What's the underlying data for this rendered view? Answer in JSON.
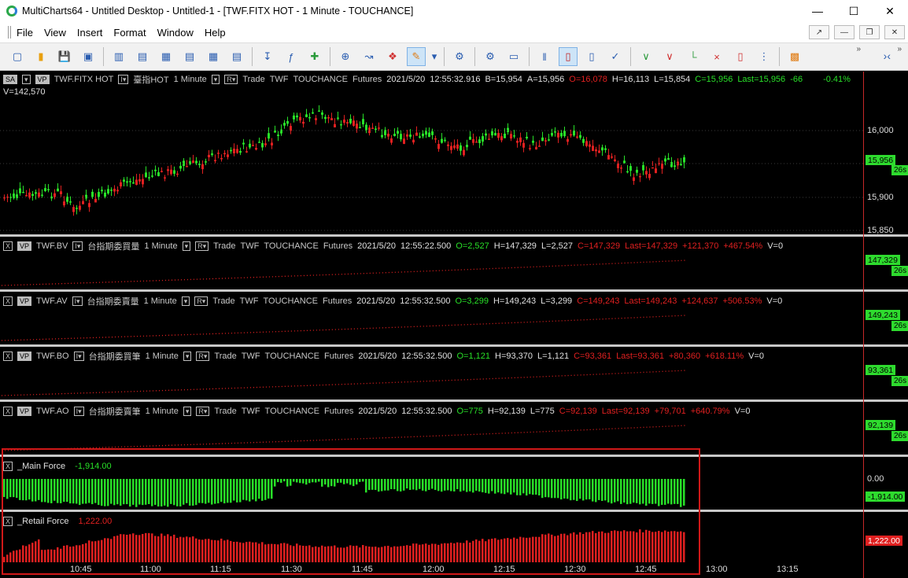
{
  "window": {
    "title": "MultiCharts64 - Untitled Desktop - Untitled-1 - [TWF.FITX HOT - 1 Minute - TOUCHANCE]"
  },
  "menu": [
    "File",
    "View",
    "Insert",
    "Format",
    "Window",
    "Help"
  ],
  "main_pane": {
    "symbol": "TWF.FITX HOT",
    "name": "臺指HOT",
    "interval": "1 Minute",
    "trade": "Trade",
    "exch": "TWF",
    "feed": "TOUCHANCE",
    "category": "Futures",
    "date": "2021/5/20",
    "time": "12:55:32.916",
    "bid": "B=15,954",
    "ask": "A=15,956",
    "open": "O=16,078",
    "high": "H=16,113",
    "low": "L=15,854",
    "close": "C=15,956",
    "last": "Last=15,956",
    "change": "-66",
    "pct": "-0.41%",
    "volume": "V=142,570",
    "axis": [
      "16,000",
      "15,900",
      "15,850"
    ],
    "price_tag": "15,956",
    "timer": "26s"
  },
  "sub_panes": [
    {
      "symbol": "TWF.BV",
      "name": "台指期委買量",
      "interval": "1 Minute",
      "time": "12:55:22.500",
      "open": "O=2,527",
      "high": "H=147,329",
      "low": "L=2,527",
      "close": "C=147,329",
      "last": "Last=147,329",
      "change": "+121,370",
      "pct": "+467.54%",
      "vol": "V=0",
      "tag": "147,329",
      "timer": "26s"
    },
    {
      "symbol": "TWF.AV",
      "name": "台指期委賣量",
      "interval": "1 Minute",
      "time": "12:55:32.500",
      "open": "O=3,299",
      "high": "H=149,243",
      "low": "L=3,299",
      "close": "C=149,243",
      "last": "Last=149,243",
      "change": "+124,637",
      "pct": "+506.53%",
      "vol": "V=0",
      "tag": "149,243",
      "timer": "26s"
    },
    {
      "symbol": "TWF.BO",
      "name": "台指期委買筆",
      "interval": "1 Minute",
      "time": "12:55:32.500",
      "open": "O=1,121",
      "high": "H=93,370",
      "low": "L=1,121",
      "close": "C=93,361",
      "last": "Last=93,361",
      "change": "+80,360",
      "pct": "+618.11%",
      "vol": "V=0",
      "tag": "93,361",
      "timer": "26s"
    },
    {
      "symbol": "TWF.AO",
      "name": "台指期委賣筆",
      "interval": "1 Minute",
      "time": "12:55:32.500",
      "open": "O=775",
      "high": "H=92,139",
      "low": "L=775",
      "close": "C=92,139",
      "last": "Last=92,139",
      "change": "+79,701",
      "pct": "+640.79%",
      "vol": "V=0",
      "tag": "92,139",
      "timer": "26s"
    }
  ],
  "common": {
    "trade": "Trade",
    "exch": "TWF",
    "feed": "TOUCHANCE",
    "category": "Futures",
    "date": "2021/5/20",
    "vp": "VP",
    "sa": "SA",
    "x": "X"
  },
  "main_force": {
    "label": "_Main Force",
    "value": "-1,914.00",
    "axis": "0.00",
    "tag": "-1,914.00"
  },
  "retail_force": {
    "label": "_Retail Force",
    "value": "1,222.00",
    "tag": "1,222.00"
  },
  "time_axis": [
    "10:45",
    "11:00",
    "11:15",
    "11:30",
    "11:45",
    "12:00",
    "12:15",
    "12:30",
    "12:45",
    "13:00",
    "13:15"
  ],
  "colors": {
    "up": "#28e028",
    "down": "#e02020",
    "background": "#000000",
    "separator": "#c8c8c8"
  }
}
